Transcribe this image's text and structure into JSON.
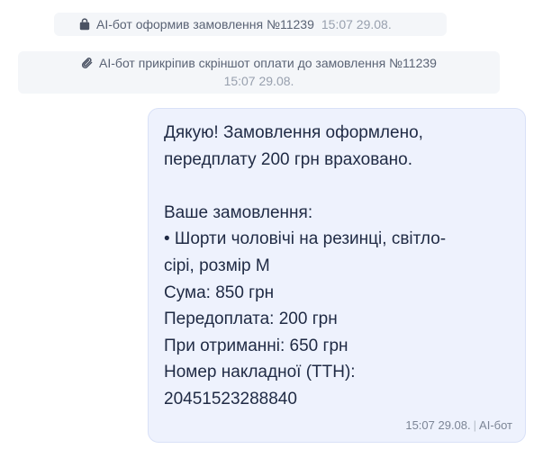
{
  "events": [
    {
      "icon": "shopping-bag-icon",
      "text": "AI-бот оформив замовлення №11239",
      "time": "15:07 29.08."
    },
    {
      "icon": "paperclip-icon",
      "text": "AI-бот прикріпив скріншот оплати до замовлення №11239",
      "time": "15:07 29.08."
    }
  ],
  "message": {
    "lines": [
      "Дякую! Замовлення оформлено,",
      "передплату 200 грн враховано.",
      "",
      "Ваше замовлення:",
      "• Шорти чоловічі на резинці, світло-",
      "сірі, розмір M",
      "Сума: 850 грн",
      "Передоплата: 200 грн",
      "При отриманні: 650 грн",
      "Номер накладної (ТТН):",
      "20451523288840"
    ],
    "time": "15:07 29.08.",
    "separator": "|",
    "sender": "AI-бот"
  },
  "colors": {
    "bubble_bg": "#eef2fd",
    "event_bg": "#f4f6f9",
    "text": "#1f2a44",
    "muted": "#98a0ae"
  }
}
